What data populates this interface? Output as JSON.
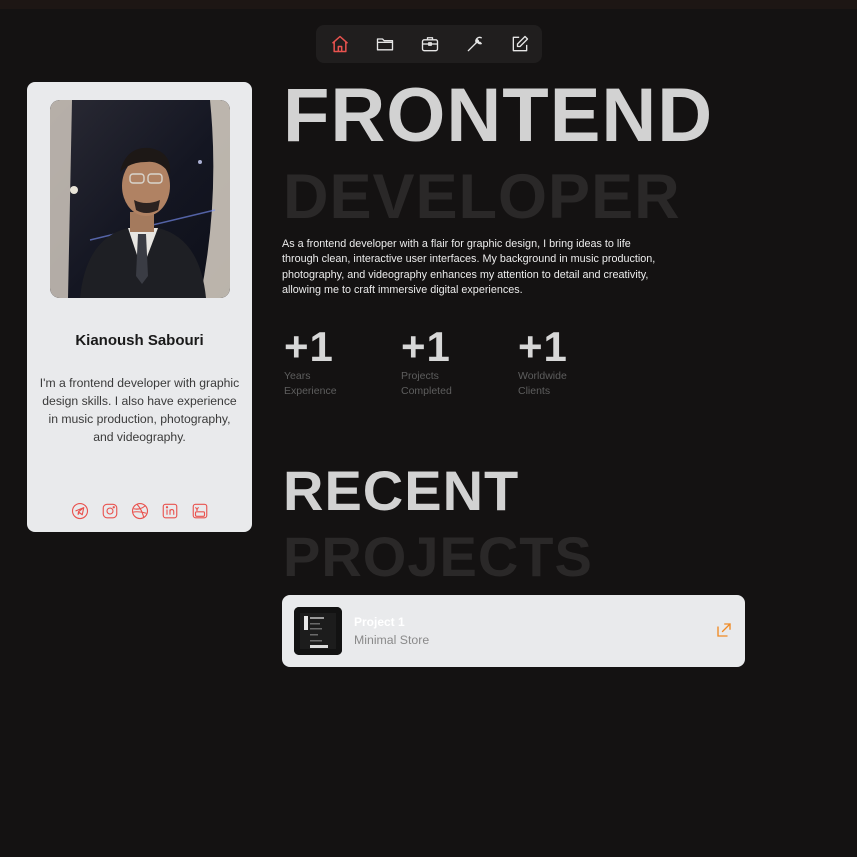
{
  "nav": {
    "items": [
      {
        "icon": "home-icon",
        "active": true
      },
      {
        "icon": "folder-icon",
        "active": false
      },
      {
        "icon": "briefcase-icon",
        "active": false
      },
      {
        "icon": "wrench-icon",
        "active": false
      },
      {
        "icon": "edit-icon",
        "active": false
      }
    ]
  },
  "profile": {
    "name": "Kianoush Sabouri",
    "bio": "I'm a frontend developer with graphic design skills. I also have experience in music production, photography, and videography.",
    "socials": [
      {
        "icon": "telegram-icon"
      },
      {
        "icon": "instagram-icon"
      },
      {
        "icon": "dribbble-icon"
      },
      {
        "icon": "linkedin-icon"
      },
      {
        "icon": "youtube-icon"
      }
    ]
  },
  "hero": {
    "title_line1": "FRONTEND",
    "title_line2": "DEVELOPER",
    "intro": "As a frontend developer with a flair for graphic design, I bring ideas to life through clean, interactive user interfaces. My background in music production, photography, and videography enhances my attention to detail and creativity, allowing me to craft immersive digital experiences."
  },
  "stats": [
    {
      "value": "+1",
      "label_line1": "Years",
      "label_line2": "Experience"
    },
    {
      "value": "+1",
      "label_line1": "Projects",
      "label_line2": "Completed"
    },
    {
      "value": "+1",
      "label_line1": "Worldwide",
      "label_line2": "Clients"
    }
  ],
  "recent": {
    "title_line1": "RECENT",
    "title_line2": "PROJECTS",
    "projects": [
      {
        "title": "Project 1",
        "subtitle": "Minimal Store",
        "icon": "external-link-icon"
      }
    ]
  },
  "colors": {
    "background": "#141212",
    "accent": "#e9534f",
    "link_accent": "#f08a24",
    "card": "#e9eaec"
  }
}
